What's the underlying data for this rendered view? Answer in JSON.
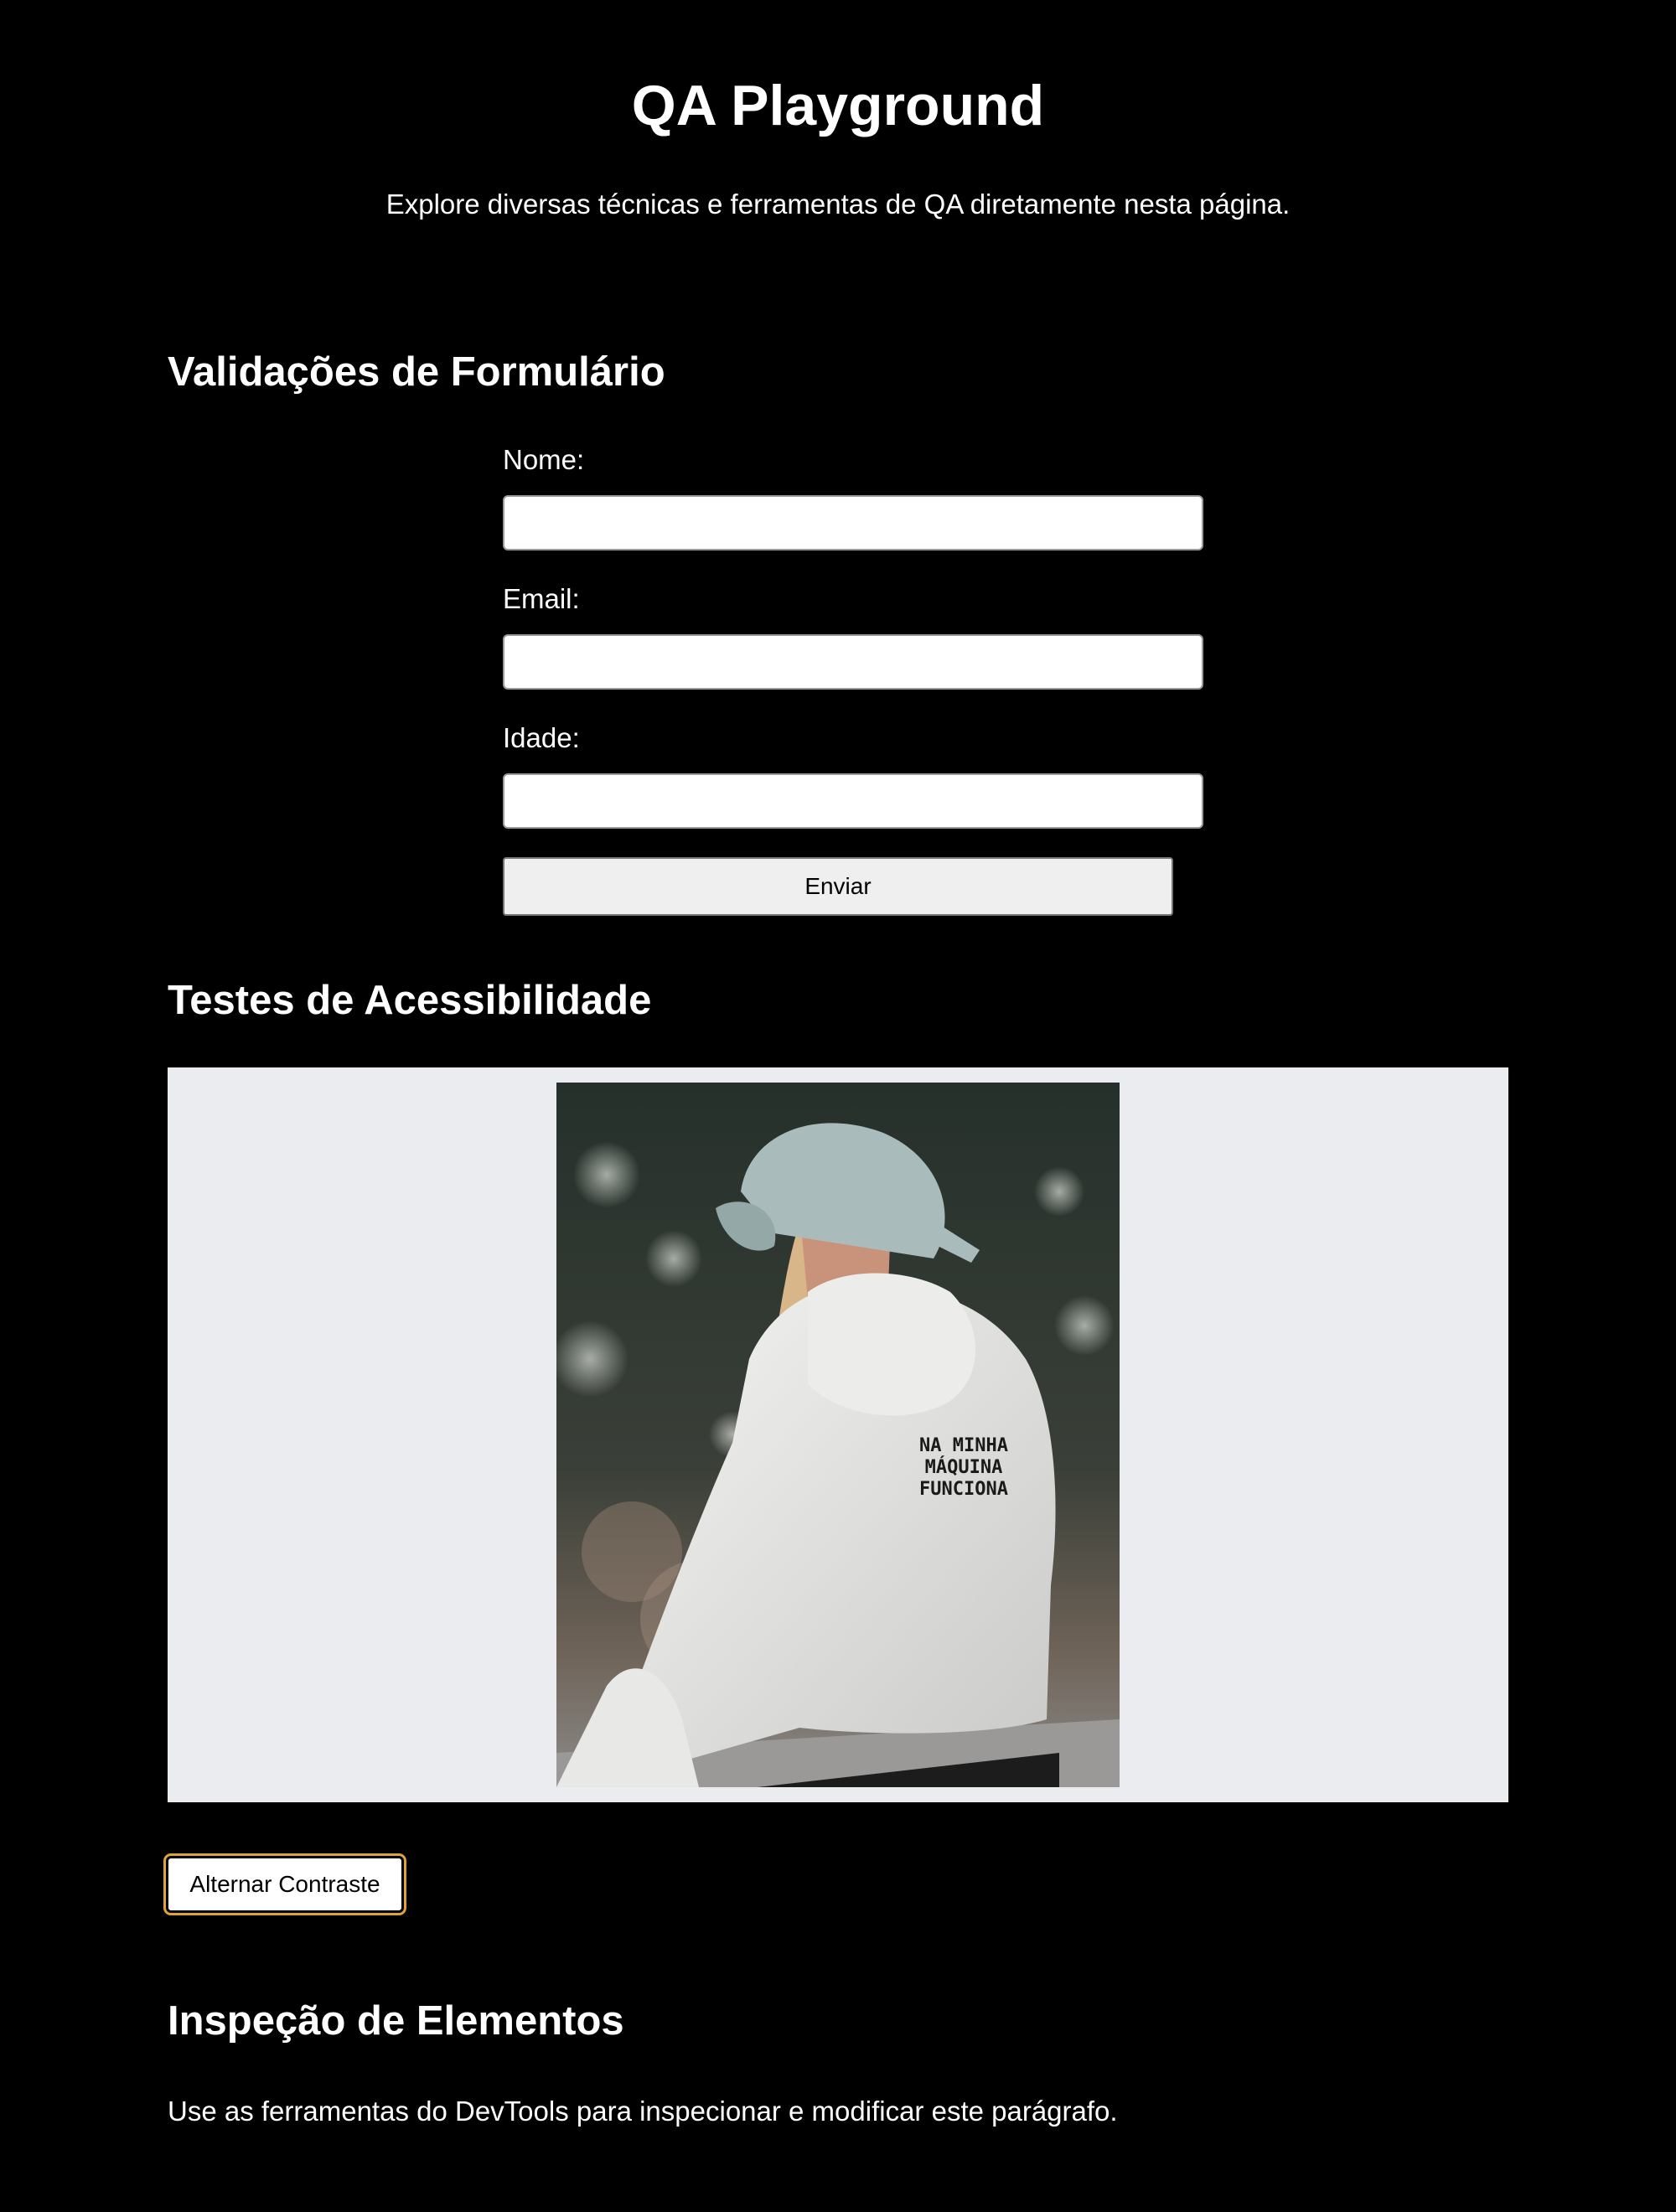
{
  "header": {
    "title": "QA Playground",
    "subtitle": "Explore diversas técnicas e ferramentas de QA diretamente nesta página."
  },
  "form_section": {
    "heading": "Validações de Formulário",
    "fields": [
      {
        "label": "Nome:",
        "value": ""
      },
      {
        "label": "Email:",
        "value": ""
      },
      {
        "label": "Idade:",
        "value": ""
      }
    ],
    "submit_label": "Enviar"
  },
  "accessibility_section": {
    "heading": "Testes de Acessibilidade",
    "image_icon": "photo-of-person-in-white-hoodie-and-cap",
    "hoodie_print": [
      "NA MINHA",
      "MÁQUINA",
      "FUNCIONA"
    ],
    "contrast_button_label": "Alternar Contraste"
  },
  "inspection_section": {
    "heading": "Inspeção de Elementos",
    "paragraph": "Use as ferramentas do DevTools para inspecionar e modificar este parágrafo."
  },
  "colors": {
    "page_background": "#000000",
    "text": "#ffffff",
    "image_panel_background": "#ebecef",
    "button_background": "#efefef",
    "focus_ring": "#e0a33a"
  }
}
